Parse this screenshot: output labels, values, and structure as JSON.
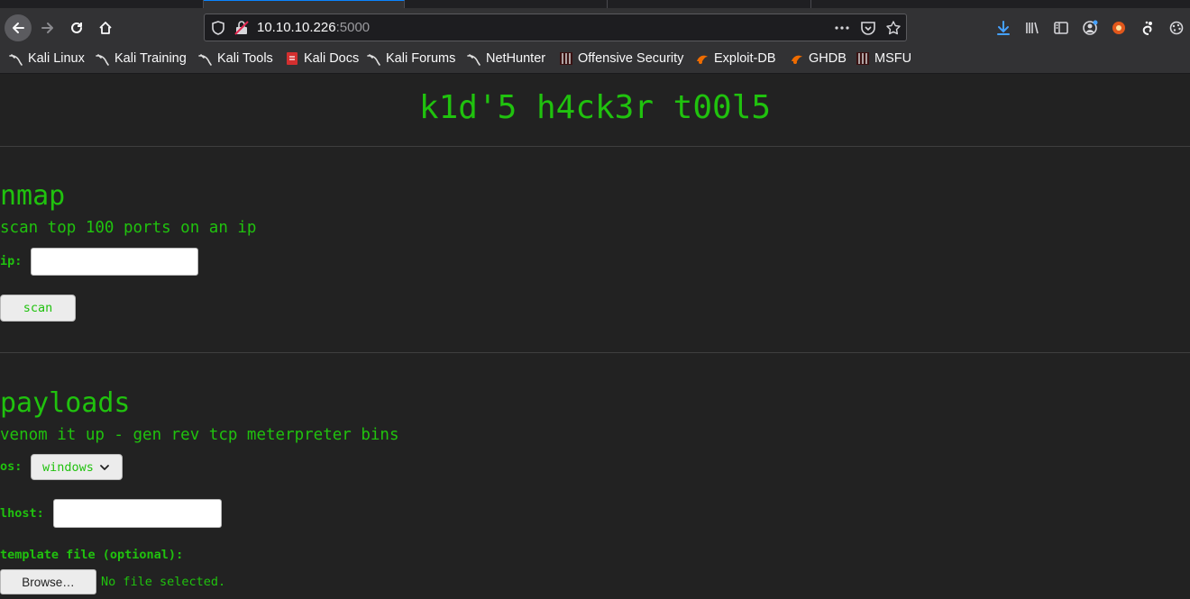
{
  "browser": {
    "url_host": "10.10.10.226",
    "url_port": ":5000",
    "bookmarks": [
      {
        "label": "Kali Linux",
        "icon": "kali-dragon-icon"
      },
      {
        "label": "Kali Training",
        "icon": "kali-dragon-icon"
      },
      {
        "label": "Kali Tools",
        "icon": "kali-dragon-icon"
      },
      {
        "label": "Kali Docs",
        "icon": "kali-docs-icon"
      },
      {
        "label": "Kali Forums",
        "icon": "kali-dragon-icon"
      },
      {
        "label": "NetHunter",
        "icon": "kali-dragon-icon"
      },
      {
        "label": "Offensive Security",
        "icon": "offsec-icon"
      },
      {
        "label": "Exploit-DB",
        "icon": "exploit-db-icon"
      },
      {
        "label": "GHDB",
        "icon": "ghdb-icon"
      },
      {
        "label": "MSFU",
        "icon": "offsec-icon"
      }
    ]
  },
  "page": {
    "title": "k1d'5 h4ck3r t00l5",
    "nmap": {
      "heading": "nmap",
      "description": "scan top 100 ports on an ip",
      "ip_label": "ip:",
      "ip_value": "",
      "scan_button": "scan"
    },
    "payloads": {
      "heading": "payloads",
      "description": "venom it up - gen rev tcp meterpreter bins",
      "os_label": "os:",
      "os_selected": "windows",
      "lhost_label": "lhost:",
      "lhost_value": "",
      "template_label": "template file (optional):",
      "browse_button": "Browse…",
      "no_file_text": "No file selected."
    }
  },
  "colors": {
    "accent_green": "#20c20e",
    "page_background": "#222222",
    "chrome_background": "#323234"
  }
}
